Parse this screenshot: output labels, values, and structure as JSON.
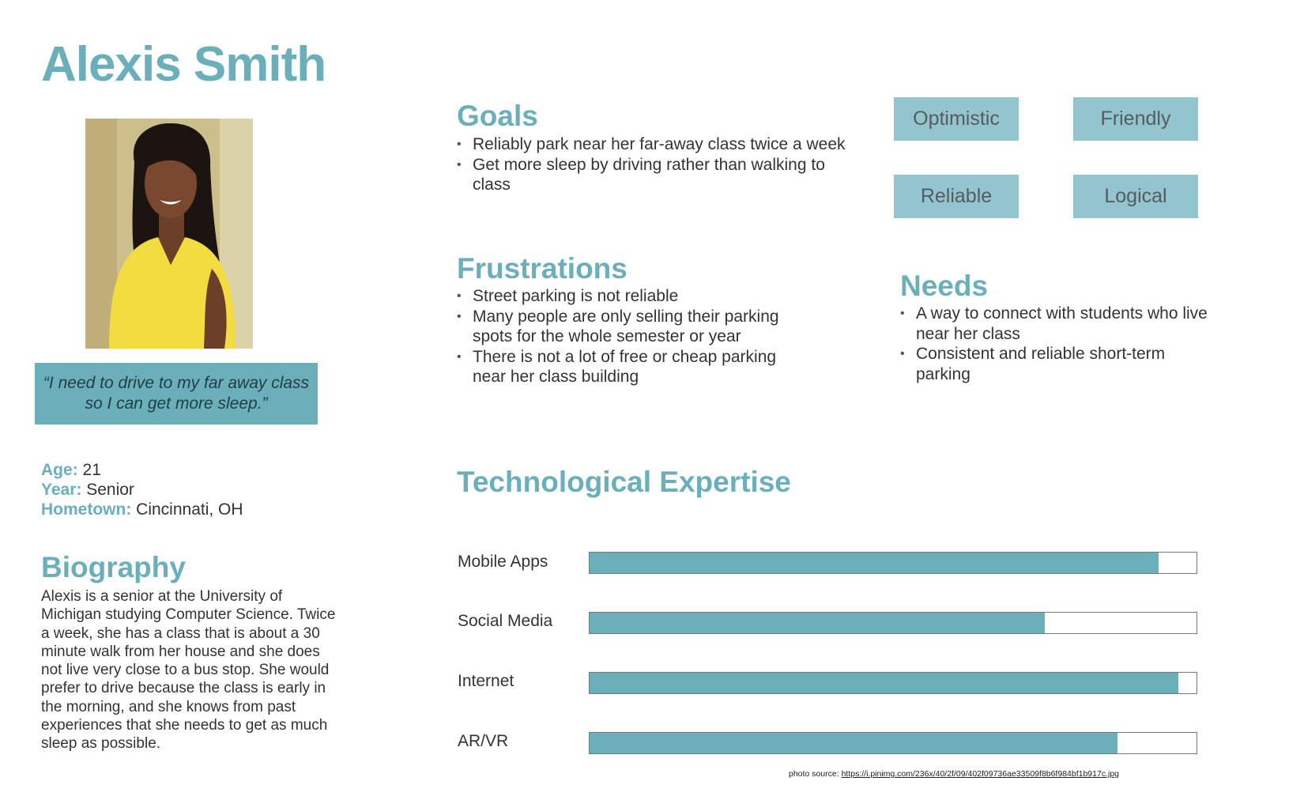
{
  "persona": {
    "name": "Alexis Smith",
    "quote": "“I need to drive to my far away class so I can get more sleep.”",
    "attributes": [
      {
        "label": "Age:",
        "value": "21"
      },
      {
        "label": "Year:",
        "value": "Senior"
      },
      {
        "label": "Hometown:",
        "value": "Cincinnati, OH"
      }
    ]
  },
  "biography": {
    "title": "Biography",
    "text": "Alexis is a senior at the University of Michigan studying Computer Science. Twice a week, she has a class that is about a 30 minute walk from her house and she does not live very close to a bus stop. She would prefer to drive because the class is early in the morning, and she knows from past experiences that she needs to get as much sleep as possible."
  },
  "goals": {
    "title": "Goals",
    "items": [
      "Reliably park near her far-away class twice a week",
      "Get more sleep by driving rather than walking to class"
    ]
  },
  "frustrations": {
    "title": "Frustrations",
    "items": [
      "Street parking is not reliable",
      "Many people are only selling their parking spots for the whole semester or year",
      "There is not a lot of free or cheap parking near her class building"
    ]
  },
  "needs": {
    "title": "Needs",
    "items": [
      "A way to connect with students who live near her class",
      "Consistent and reliable short-term parking"
    ]
  },
  "traits": [
    "Optimistic",
    "Friendly",
    "Reliable",
    "Logical"
  ],
  "tech": {
    "title": "Technological Expertise",
    "skills": [
      {
        "label": "Mobile Apps",
        "level": 0.937
      },
      {
        "label": "Social Media",
        "level": 0.75
      },
      {
        "label": "Internet",
        "level": 0.97
      },
      {
        "label": "AR/VR",
        "level": 0.87
      }
    ]
  },
  "footer": {
    "photo_source_label": "photo source:",
    "photo_source_url": "https://i.pinimg.com/236x/40/2f/09/402f09736ae33509f8b6f984bf1b917c.jpg"
  },
  "colors": {
    "accent": "#6AAFBA",
    "trait_bg": "#93C5CE"
  },
  "icons": {
    "photo": "persona-portrait-photo"
  }
}
